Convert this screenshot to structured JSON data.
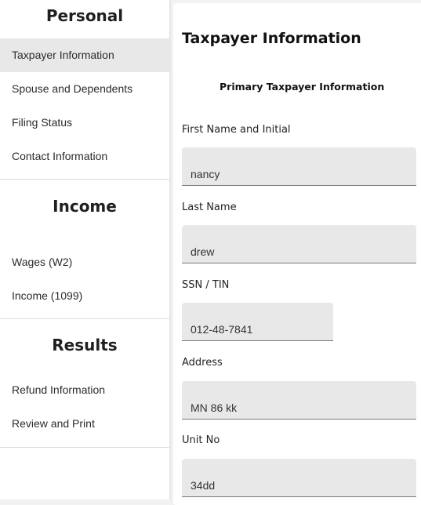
{
  "sidebar": {
    "sections": [
      {
        "title": "Personal",
        "items": [
          {
            "label": "Taxpayer Information",
            "active": true
          },
          {
            "label": "Spouse and Dependents"
          },
          {
            "label": "Filing Status"
          },
          {
            "label": "Contact Information"
          }
        ]
      },
      {
        "title": "Income",
        "items": [
          {
            "label": "Wages (W2)"
          },
          {
            "label": "Income (1099)"
          }
        ]
      },
      {
        "title": "Results",
        "items": [
          {
            "label": "Refund Information"
          },
          {
            "label": "Review and Print"
          }
        ]
      }
    ]
  },
  "main": {
    "title": "Taxpayer Information",
    "subtitle": "Primary Taxpayer Information",
    "fields": [
      {
        "label": "First Name and Initial",
        "value": "nancy"
      },
      {
        "label": "Last Name",
        "value": "drew"
      },
      {
        "label": "SSN / TIN",
        "value": "012-48-7841"
      },
      {
        "label": "Address",
        "value": "MN 86 kk"
      },
      {
        "label": "Unit No",
        "value": "34dd"
      }
    ]
  },
  "colors": {
    "active_nav_bg": "#e8e8e8",
    "input_bg": "#e8e8e8",
    "page_bg": "#f2f2f2"
  }
}
